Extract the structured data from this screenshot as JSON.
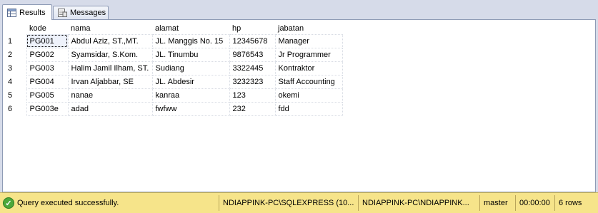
{
  "tabs": {
    "results_label": "Results",
    "messages_label": "Messages"
  },
  "grid": {
    "columns": [
      "",
      "kode",
      "nama",
      "alamat",
      "hp",
      "jabatan"
    ],
    "rows": [
      [
        "1",
        "PG001",
        "Abdul Aziz, ST.,MT.",
        "JL. Manggis No. 15",
        "12345678",
        "Manager"
      ],
      [
        "2",
        "PG002",
        "Syamsidar, S.Kom.",
        "JL. Tinumbu",
        "9876543",
        "Jr Programmer"
      ],
      [
        "3",
        "PG003",
        "Halim Jamil Ilham, ST.",
        "Sudiang",
        "3322445",
        "Kontraktor"
      ],
      [
        "4",
        "PG004",
        "Irvan Aljabbar, SE",
        "JL. Abdesir",
        "3232323",
        "Staff Accounting"
      ],
      [
        "5",
        "PG005",
        "nanae",
        "kanraa",
        "123",
        "okemi"
      ],
      [
        "6",
        "PG003e",
        "adad",
        "fwfww",
        "232",
        "fdd"
      ]
    ]
  },
  "status": {
    "message": "Query executed successfully.",
    "server": "NDIAPPINK-PC\\SQLEXPRESS (10...",
    "user": "NDIAPPINK-PC\\NDIAPPINK...",
    "database": "master",
    "elapsed": "00:00:00",
    "rows": "6 rows"
  }
}
